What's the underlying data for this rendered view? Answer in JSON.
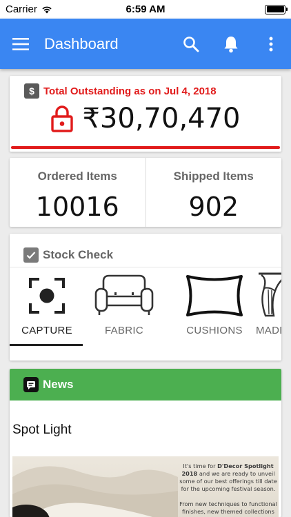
{
  "status_bar": {
    "carrier": "Carrier",
    "time": "6:59 AM"
  },
  "app_bar": {
    "title": "Dashboard"
  },
  "outstanding": {
    "label": "Total Outstanding as on Jul 4, 2018",
    "amount": "₹30,70,470"
  },
  "items": {
    "ordered_label": "Ordered Items",
    "ordered_value": "10016",
    "shipped_label": "Shipped Items",
    "shipped_value": "902"
  },
  "stock_check": {
    "label": "Stock Check",
    "tabs": [
      {
        "label": "CAPTURE",
        "icon": "capture-icon"
      },
      {
        "label": "FABRIC",
        "icon": "sofa-icon"
      },
      {
        "label": "CUSHIONS",
        "icon": "cushion-icon"
      },
      {
        "label": "MADE",
        "icon": "curtain-icon"
      }
    ]
  },
  "news": {
    "label": "News",
    "item_title": "Spot Light",
    "item_text_1": "It's time for",
    "item_text_brand": "D'Decor Spotlight 2018",
    "item_text_2": "and we are ready to unveil some of our best offerings till date for the upcoming festival season.",
    "item_text_3": "From new techniques to functional finishes, new themed collections to"
  },
  "colors": {
    "app_bar": "#3a86f2",
    "alert_red": "#e11b1b",
    "news_green": "#4caf50",
    "background": "#ececec"
  }
}
